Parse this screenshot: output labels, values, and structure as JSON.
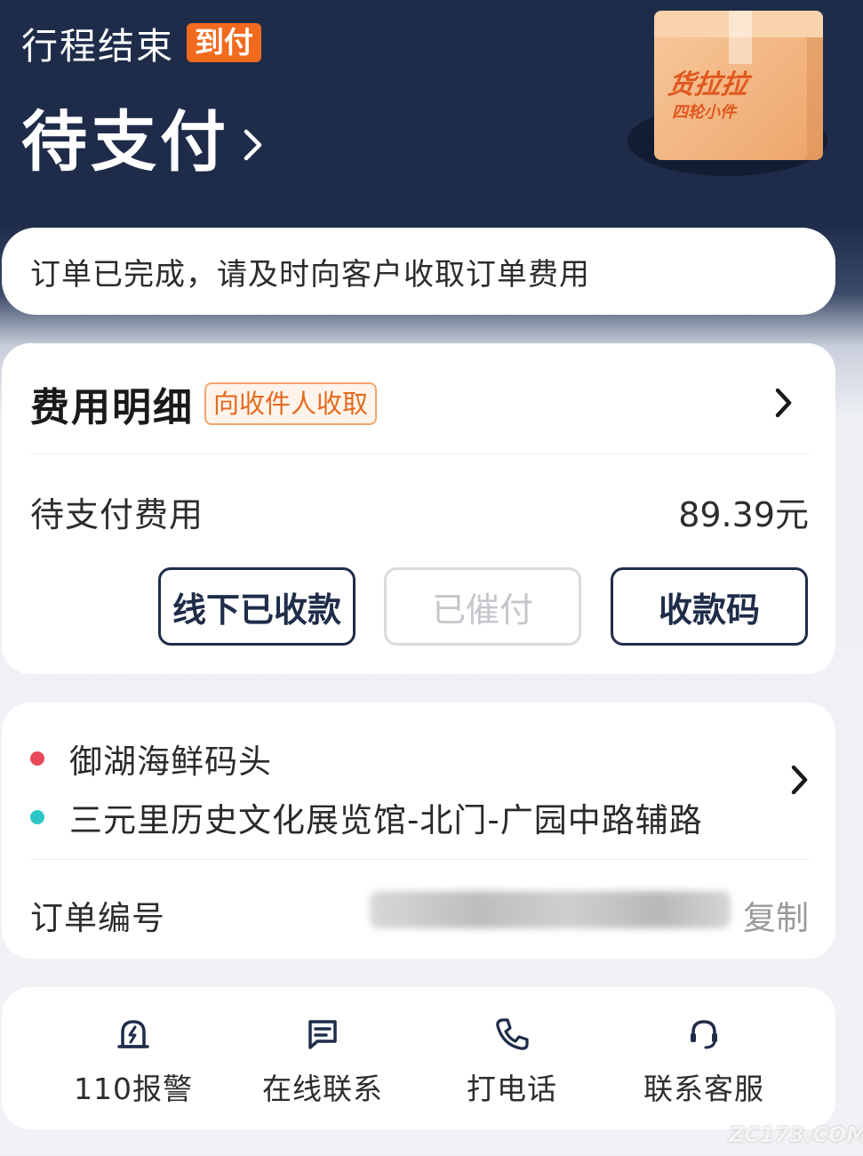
{
  "header": {
    "status": "行程结束",
    "cod_badge": "到付",
    "title": "待支付",
    "box_brand": "货拉拉",
    "box_sub": "四轮小件"
  },
  "notice": {
    "text": "订单已完成，请及时向客户收取订单费用"
  },
  "fee_card": {
    "title": "费用明细",
    "badge": "向收件人收取",
    "pending_label": "待支付费用",
    "pending_amount": "89.39元",
    "buttons": {
      "offline_paid": "线下已收款",
      "reminded": "已催付",
      "pay_code": "收款码"
    }
  },
  "route_card": {
    "pickup": "御湖海鲜码头",
    "dropoff": "三元里历史文化展览馆-北门-广园中路辅路",
    "order_label": "订单编号",
    "copy_label": "复制"
  },
  "actions": [
    {
      "label": "110报警",
      "icon": "police-alarm-icon"
    },
    {
      "label": "在线联系",
      "icon": "chat-icon"
    },
    {
      "label": "打电话",
      "icon": "phone-icon"
    },
    {
      "label": "联系客服",
      "icon": "headset-icon"
    }
  ],
  "watermark": "ZC173.COM",
  "colors": {
    "header_bg": "#1e2c4a",
    "accent_orange": "#f26a1d",
    "pickup_dot": "#e8485a",
    "dropoff_dot": "#2cc6c6"
  }
}
